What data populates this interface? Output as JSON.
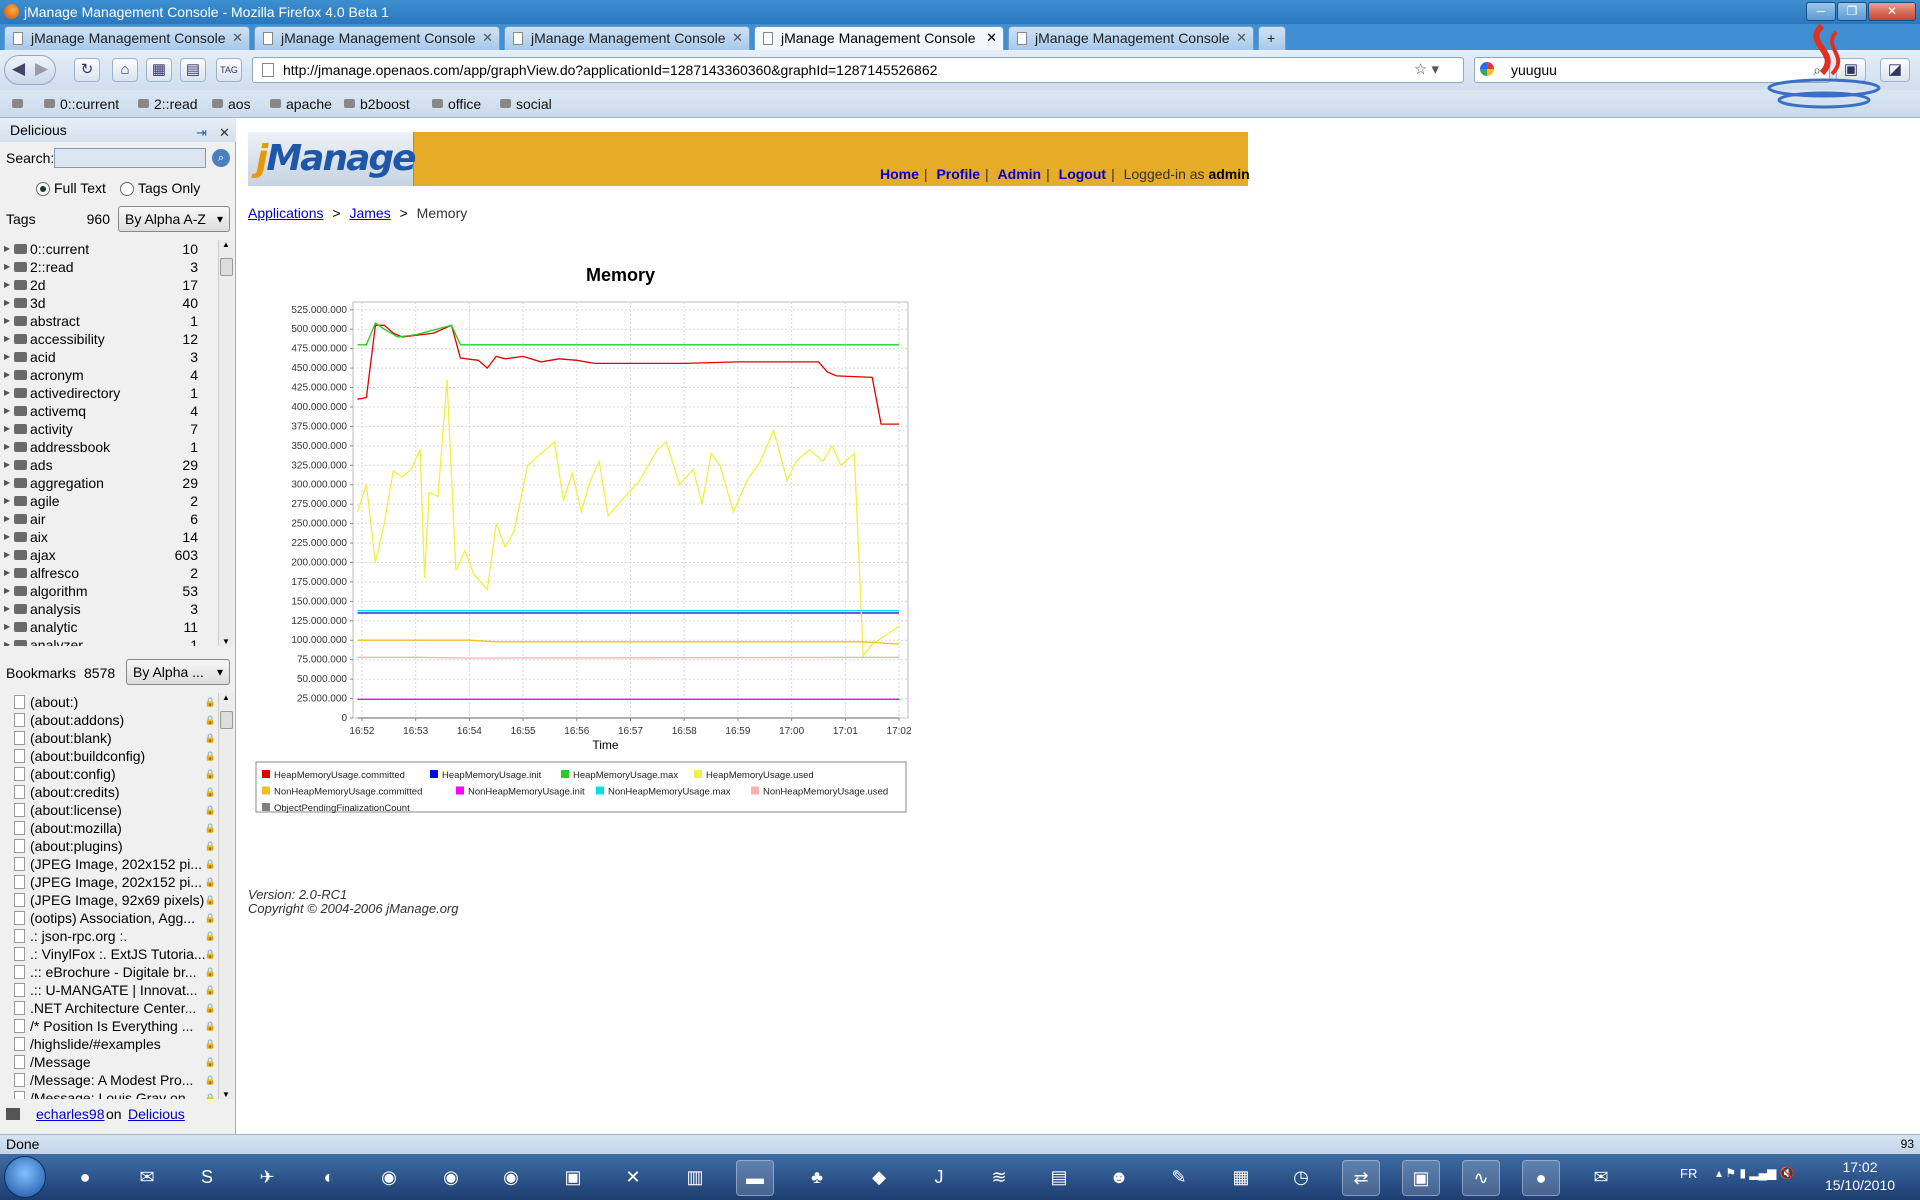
{
  "window": {
    "title": "jManage Management Console - Mozilla Firefox 4.0 Beta 1"
  },
  "tabs": [
    {
      "label": "jManage Management Console"
    },
    {
      "label": "jManage Management Console"
    },
    {
      "label": "jManage Management Console"
    },
    {
      "label": "jManage Management Console"
    },
    {
      "label": "jManage Management Console"
    }
  ],
  "nav": {
    "url": "http://jmanage.openaos.com/app/graphView.do?applicationId=1287143360360&graphId=1287145526862",
    "search_value": "yuuguu"
  },
  "bookmarks_bar": [
    "0::current",
    "2::read",
    "aos",
    "apache",
    "b2boost",
    "office",
    "social"
  ],
  "sidebar": {
    "title": "Delicious",
    "search_label": "Search:",
    "search_value": "",
    "radio_fulltext": "Full Text",
    "radio_tagsonly": "Tags Only",
    "tags_label": "Tags",
    "tags_count": "960",
    "tags_sort": "By Alpha A-Z",
    "tags": [
      {
        "name": "0::current",
        "count": "10"
      },
      {
        "name": "2::read",
        "count": "3"
      },
      {
        "name": "2d",
        "count": "17"
      },
      {
        "name": "3d",
        "count": "40"
      },
      {
        "name": "abstract",
        "count": "1"
      },
      {
        "name": "accessibility",
        "count": "12"
      },
      {
        "name": "acid",
        "count": "3"
      },
      {
        "name": "acronym",
        "count": "4"
      },
      {
        "name": "activedirectory",
        "count": "1"
      },
      {
        "name": "activemq",
        "count": "4"
      },
      {
        "name": "activity",
        "count": "7"
      },
      {
        "name": "addressbook",
        "count": "1"
      },
      {
        "name": "ads",
        "count": "29"
      },
      {
        "name": "aggregation",
        "count": "29"
      },
      {
        "name": "agile",
        "count": "2"
      },
      {
        "name": "air",
        "count": "6"
      },
      {
        "name": "aix",
        "count": "14"
      },
      {
        "name": "ajax",
        "count": "603"
      },
      {
        "name": "alfresco",
        "count": "2"
      },
      {
        "name": "algorithm",
        "count": "53"
      },
      {
        "name": "analysis",
        "count": "3"
      },
      {
        "name": "analytic",
        "count": "11"
      },
      {
        "name": "analyzer",
        "count": "1"
      }
    ],
    "bookmarks_label": "Bookmarks",
    "bookmarks_count": "8578",
    "bookmarks_sort": "By Alpha ...",
    "bookmarks": [
      "(about:)",
      "(about:addons)",
      "(about:blank)",
      "(about:buildconfig)",
      "(about:config)",
      "(about:credits)",
      "(about:license)",
      "(about:mozilla)",
      "(about:plugins)",
      "(JPEG Image, 202x152 pi...",
      "(JPEG Image, 202x152 pi...",
      "(JPEG Image, 92x69 pixels)",
      "(ootips) Association, Agg...",
      ".: json-rpc.org :.",
      ".: VinylFox :. ExtJS Tutoria...",
      ".:: eBrochure - Digitale br...",
      ".:: U-MANGATE | Innovat...",
      ".NET Architecture Center...",
      "/* Position Is Everything ...",
      "/highslide/#examples",
      "/Message",
      "/Message: A Modest Pro...",
      "/Message: Louis Gray on..."
    ],
    "footer_user": "echarles98",
    "footer_on": "on",
    "footer_site": "Delicious"
  },
  "header": {
    "logo_j": "j",
    "logo_rest": "Manage",
    "links": {
      "home": "Home",
      "profile": "Profile",
      "admin": "Admin",
      "logout": "Logout"
    },
    "logged_in_prefix": "Logged-in as",
    "logged_in_user": "admin"
  },
  "breadcrumb": {
    "applications": "Applications",
    "james": "James",
    "current": "Memory",
    "sep": ">"
  },
  "chart_data": {
    "type": "line",
    "title": "Memory",
    "xlabel": "Time",
    "ylabel": "",
    "ylim": [
      0,
      535000000
    ],
    "yticks": [
      "0",
      "25.000.000",
      "50.000.000",
      "75.000.000",
      "100.000.000",
      "125.000.000",
      "150.000.000",
      "175.000.000",
      "200.000.000",
      "225.000.000",
      "250.000.000",
      "275.000.000",
      "300.000.000",
      "325.000.000",
      "350.000.000",
      "375.000.000",
      "400.000.000",
      "425.000.000",
      "450.000.000",
      "475.000.000",
      "500.000.000",
      "525.000.000"
    ],
    "xticks": [
      "16:52",
      "16:53",
      "16:54",
      "16:55",
      "16:56",
      "16:57",
      "16:58",
      "16:59",
      "17:00",
      "17:01",
      "17:02"
    ],
    "xlim": [
      "16:51:50",
      "17:02:10"
    ],
    "grid": true,
    "legend_position": "bottom",
    "series": [
      {
        "name": "HeapMemoryUsage.committed",
        "color": "#e00000",
        "x": [
          "16:51:55",
          "16:52:05",
          "16:52:15",
          "16:52:25",
          "16:52:35",
          "16:52:45",
          "16:53:00",
          "16:53:20",
          "16:53:40",
          "16:53:50",
          "16:54:10",
          "16:54:20",
          "16:54:30",
          "16:54:40",
          "16:55:00",
          "16:55:20",
          "16:55:40",
          "16:56:00",
          "16:56:20",
          "16:57:00",
          "16:58:00",
          "16:59:00",
          "17:00:00",
          "17:00:30",
          "17:00:40",
          "17:00:50",
          "17:01:30",
          "17:01:40",
          "17:02:00"
        ],
        "values": [
          410000000,
          412000000,
          505000000,
          505000000,
          495000000,
          490000000,
          492000000,
          495000000,
          505000000,
          463000000,
          460000000,
          450000000,
          465000000,
          462000000,
          465000000,
          458000000,
          462000000,
          460000000,
          456000000,
          456000000,
          456000000,
          458000000,
          458000000,
          458000000,
          445000000,
          440000000,
          438000000,
          378000000,
          378000000
        ]
      },
      {
        "name": "HeapMemoryUsage.init",
        "color": "#0000e0",
        "x": [
          "16:51:55",
          "17:02:00"
        ],
        "values": [
          135000000,
          135000000
        ]
      },
      {
        "name": "HeapMemoryUsage.max",
        "color": "#20d020",
        "x": [
          "16:51:55",
          "16:52:05",
          "16:52:15",
          "16:52:25",
          "16:52:40",
          "16:53:00",
          "16:53:40",
          "16:53:50",
          "17:02:00"
        ],
        "values": [
          480000000,
          480000000,
          508000000,
          500000000,
          490000000,
          493000000,
          505000000,
          480000000,
          480000000
        ]
      },
      {
        "name": "HeapMemoryUsage.used",
        "color": "#f0f040",
        "x": [
          "16:51:55",
          "16:52:05",
          "16:52:15",
          "16:52:25",
          "16:52:35",
          "16:52:45",
          "16:52:55",
          "16:53:05",
          "16:53:10",
          "16:53:15",
          "16:53:25",
          "16:53:35",
          "16:53:45",
          "16:53:55",
          "16:54:05",
          "16:54:20",
          "16:54:30",
          "16:54:40",
          "16:54:50",
          "16:55:05",
          "16:55:20",
          "16:55:35",
          "16:55:45",
          "16:55:55",
          "16:56:05",
          "16:56:15",
          "16:56:25",
          "16:56:35",
          "16:56:50",
          "16:57:10",
          "16:57:30",
          "16:57:40",
          "16:57:55",
          "16:58:10",
          "16:58:20",
          "16:58:30",
          "16:58:40",
          "16:58:55",
          "16:59:10",
          "16:59:25",
          "16:59:40",
          "16:59:55",
          "17:00:05",
          "17:00:20",
          "17:00:35",
          "17:00:45",
          "17:00:55",
          "17:01:10",
          "17:01:20",
          "17:01:30",
          "17:01:50",
          "17:02:00"
        ],
        "values": [
          265000000,
          300000000,
          200000000,
          250000000,
          318000000,
          310000000,
          320000000,
          345000000,
          180000000,
          290000000,
          285000000,
          435000000,
          190000000,
          215000000,
          185000000,
          165000000,
          250000000,
          220000000,
          240000000,
          325000000,
          340000000,
          355000000,
          280000000,
          315000000,
          265000000,
          305000000,
          330000000,
          260000000,
          280000000,
          305000000,
          345000000,
          355000000,
          300000000,
          320000000,
          275000000,
          340000000,
          325000000,
          265000000,
          305000000,
          330000000,
          370000000,
          305000000,
          330000000,
          345000000,
          330000000,
          350000000,
          325000000,
          340000000,
          80000000,
          95000000,
          110000000,
          118000000
        ]
      },
      {
        "name": "NonHeapMemoryUsage.committed",
        "color": "#f0c020",
        "x": [
          "16:51:55",
          "16:53:00",
          "16:54:00",
          "16:54:30",
          "17:01:20",
          "17:02:00"
        ],
        "values": [
          100000000,
          100000000,
          100000000,
          98000000,
          98000000,
          95000000
        ]
      },
      {
        "name": "NonHeapMemoryUsage.init",
        "color": "#ff00ff",
        "x": [
          "16:51:55",
          "17:02:00"
        ],
        "values": [
          24000000,
          24000000
        ]
      },
      {
        "name": "NonHeapMemoryUsage.max",
        "color": "#00e0e0",
        "x": [
          "16:51:55",
          "17:02:00"
        ],
        "values": [
          138000000,
          138000000
        ]
      },
      {
        "name": "NonHeapMemoryUsage.used",
        "color": "#ffb0b0",
        "x": [
          "16:51:55",
          "16:53:00",
          "16:54:00",
          "17:02:00"
        ],
        "values": [
          78000000,
          78000000,
          77000000,
          78000000
        ]
      },
      {
        "name": "ObjectPendingFinalizationCount",
        "color": "#808080",
        "x": [
          "16:51:55",
          "17:02:00"
        ],
        "values": [
          0,
          0
        ]
      }
    ]
  },
  "footer": {
    "version": "Version: 2.0-RC1",
    "copyright": "Copyright © 2004-2006 jManage.org"
  },
  "statusbar": {
    "text": "Done",
    "right": "93"
  },
  "taskbar": {
    "lang": "FR",
    "time": "17:02",
    "date": "15/10/2010"
  }
}
